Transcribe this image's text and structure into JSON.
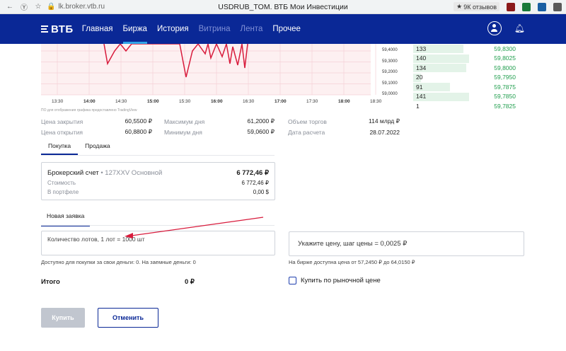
{
  "browser": {
    "url": "lk.broker.vtb.ru",
    "title": "USDRUB_TOM. ВТБ Мои Инвестиции",
    "reviews": "9К отзывов"
  },
  "nav": {
    "logo": "ВТБ",
    "items": [
      {
        "label": "Главная",
        "state": "normal"
      },
      {
        "label": "Биржа",
        "state": "active"
      },
      {
        "label": "История",
        "state": "normal"
      },
      {
        "label": "Витрина",
        "state": "muted"
      },
      {
        "label": "Лента",
        "state": "muted"
      },
      {
        "label": "Прочее",
        "state": "normal"
      }
    ],
    "colors": {
      "bg": "#0a2896",
      "active_underline": "#2fa4e7"
    }
  },
  "chart": {
    "y_ticks": [
      "59,4000",
      "59,3000",
      "59,2000",
      "59,1000",
      "59,0000"
    ],
    "x_ticks": [
      {
        "label": "13:30",
        "bold": false
      },
      {
        "label": "14:00",
        "bold": true
      },
      {
        "label": "14:30",
        "bold": false
      },
      {
        "label": "15:00",
        "bold": true
      },
      {
        "label": "15:30",
        "bold": false
      },
      {
        "label": "16:00",
        "bold": true
      },
      {
        "label": "16:30",
        "bold": false
      },
      {
        "label": "17:00",
        "bold": true
      },
      {
        "label": "17:30",
        "bold": false
      },
      {
        "label": "18:00",
        "bold": true
      },
      {
        "label": "18:30",
        "bold": false
      }
    ],
    "note": "ПО для отображения графика предоставлено TradingView",
    "line_color": "#d81b3c"
  },
  "orderbook": {
    "rows": [
      {
        "volume": "133",
        "price": "59,8300",
        "bar": 0.45
      },
      {
        "volume": "140",
        "price": "59,8025",
        "bar": 0.5
      },
      {
        "volume": "134",
        "price": "59,8000",
        "bar": 0.48
      },
      {
        "volume": "20",
        "price": "59,7950",
        "bar": 0.07
      },
      {
        "volume": "91",
        "price": "59,7875",
        "bar": 0.33
      },
      {
        "volume": "141",
        "price": "59,7850",
        "bar": 0.5
      },
      {
        "volume": "1",
        "price": "59,7825",
        "bar": 0.0
      }
    ]
  },
  "stats": {
    "col1": [
      {
        "label": "Цена закрытия",
        "value": "60,5500 ₽"
      },
      {
        "label": "Цена открытия",
        "value": "60,8800 ₽"
      }
    ],
    "col2": [
      {
        "label": "Максимум дня",
        "value": "61,2000 ₽"
      },
      {
        "label": "Минимум дня",
        "value": "59,0600 ₽"
      }
    ],
    "col3": [
      {
        "label": "Объем торгов",
        "value": "114 млрд ₽"
      },
      {
        "label": "Дата расчета",
        "value": "28.07.2022"
      }
    ]
  },
  "tabs": {
    "buy": "Покупка",
    "sell": "Продажа"
  },
  "account": {
    "title": "Брокерский счет",
    "id": "• 127XXV Основной",
    "sum": "6 772,46 ₽",
    "cost_label": "Стоимость",
    "cost_value": "6 772,46 ₽",
    "portfolio_label": "В портфеле",
    "portfolio_value": "0,00 $"
  },
  "order": {
    "tab": "Новая заявка",
    "qty_label": "Количество лотов, 1 лот = 1000 шт",
    "price_placeholder": "Укажите цену, шаг цены = 0,0025 ₽",
    "avail_note": "Доступно для покупки за свои деньги: 0. На заемные деньги: 0",
    "price_range_note": "На бирже доступна цена от 57,2450 ₽ до 64,0150 ₽",
    "total_label": "Итого",
    "total_value": "0 ₽",
    "market_price_label": "Купить по рыночной цене",
    "buy_button": "Купить",
    "cancel_button": "Отменить"
  }
}
